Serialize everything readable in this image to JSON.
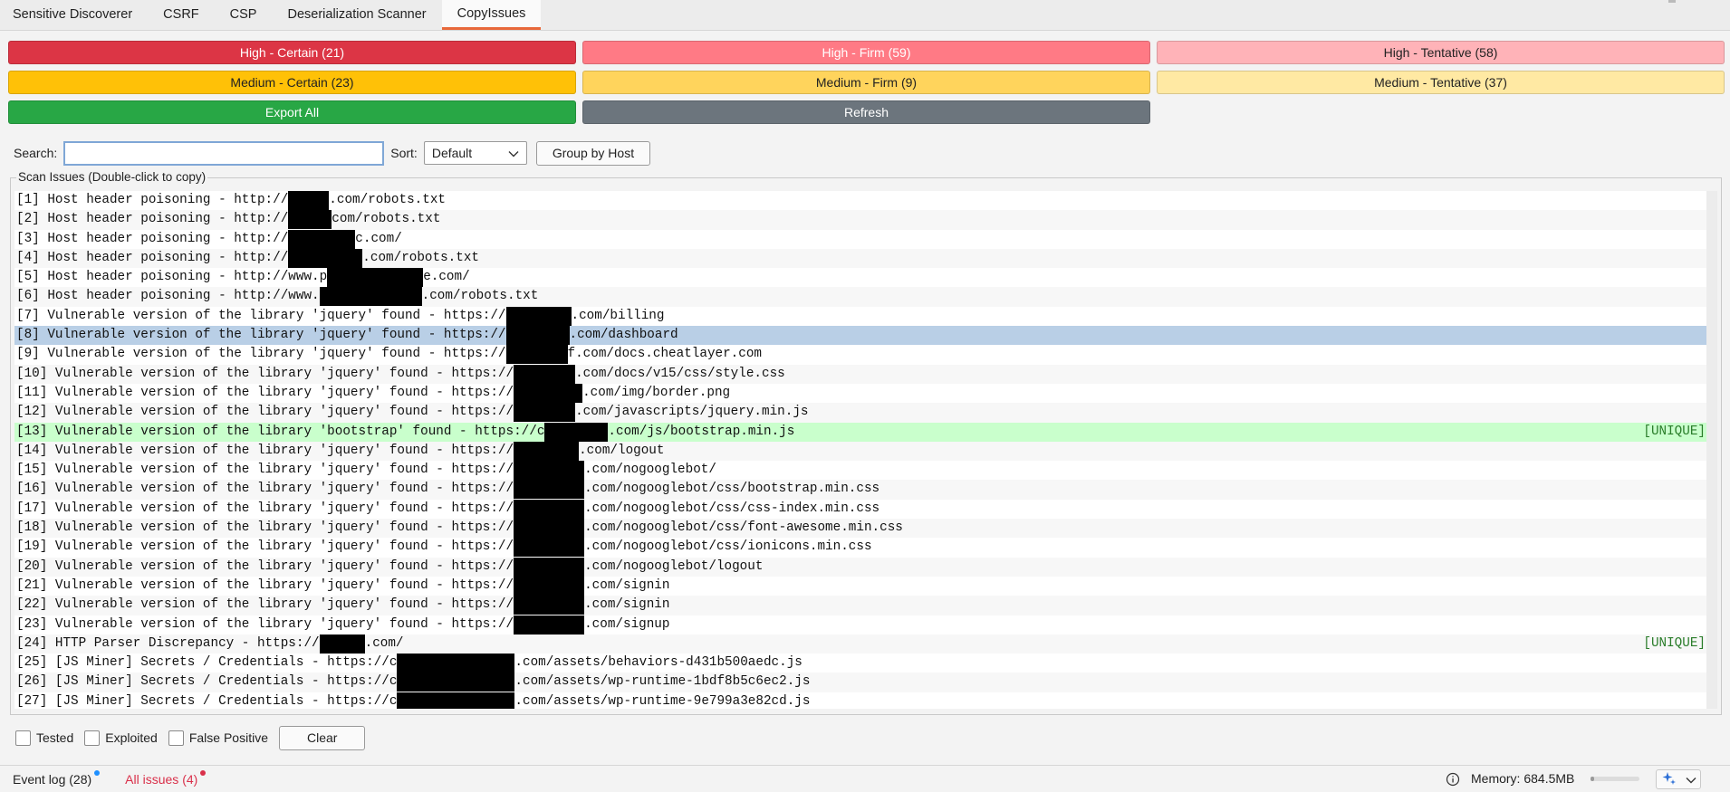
{
  "tabs": [
    {
      "label": "Sensitive Discoverer"
    },
    {
      "label": "CSRF"
    },
    {
      "label": "CSP"
    },
    {
      "label": "Deserialization Scanner"
    },
    {
      "label": "CopyIssues",
      "active": true
    }
  ],
  "severity_buttons": [
    {
      "label": "High - Certain (21)",
      "bg": "#dc3545",
      "fg": "#ffffff"
    },
    {
      "label": "High - Firm (59)",
      "bg": "#ff7a85",
      "fg": "#ffffff"
    },
    {
      "label": "High - Tentative (58)",
      "bg": "#ffb3b8",
      "fg": "#222222"
    },
    {
      "label": "Medium - Certain (23)",
      "bg": "#ffc107",
      "fg": "#222222"
    },
    {
      "label": "Medium - Firm (9)",
      "bg": "#ffd45c",
      "fg": "#222222"
    },
    {
      "label": "Medium - Tentative (37)",
      "bg": "#ffe9a3",
      "fg": "#222222"
    },
    {
      "label": "Export All",
      "bg": "#28a745",
      "fg": "#ffffff"
    },
    {
      "label": "Refresh",
      "bg": "#6c757d",
      "fg": "#ffffff"
    }
  ],
  "search": {
    "label": "Search:",
    "value": ""
  },
  "sort": {
    "label": "Sort:",
    "value": "Default"
  },
  "group_by_host_label": "Group by Host",
  "issues_panel": {
    "title": "Scan Issues (Double-click to copy)",
    "rows": [
      {
        "pre": "[1] Host header poisoning - http://",
        "redact_w": 45,
        "post": ".com/robots.txt"
      },
      {
        "pre": "[2] Host header poisoning - http://",
        "redact_w": 48,
        "post": "com/robots.txt"
      },
      {
        "pre": "[3] Host header poisoning - http://",
        "redact_w": 74,
        "post": "c.com/"
      },
      {
        "pre": "[4] Host header poisoning - http://",
        "redact_w": 82,
        "post": ".com/robots.txt"
      },
      {
        "pre": "[5] Host header poisoning - http://www.p",
        "redact_w": 106,
        "post": "e.com/"
      },
      {
        "pre": "[6] Host header poisoning - http://www.",
        "redact_w": 113,
        "post": ".com/robots.txt"
      },
      {
        "pre": "[7] Vulnerable version of the library 'jquery' found - https://",
        "redact_w": 72,
        "post": ".com/billing"
      },
      {
        "pre": "[8] Vulnerable version of the library 'jquery' found - https://",
        "redact_w": 70,
        "post": ".com/dashboard",
        "selected": true
      },
      {
        "pre": "[9] Vulnerable version of the library 'jquery' found - https://",
        "redact_w": 68,
        "post": "f.com/docs.cheatlayer.com"
      },
      {
        "pre": "[10] Vulnerable version of the library 'jquery' found - https://",
        "redact_w": 68,
        "post": ".com/docs/v15/css/style.css"
      },
      {
        "pre": "[11] Vulnerable version of the library 'jquery' found - https://",
        "redact_w": 76,
        "post": ".com/img/border.png"
      },
      {
        "pre": "[12] Vulnerable version of the library 'jquery' found - https://",
        "redact_w": 68,
        "post": ".com/javascripts/jquery.min.js"
      },
      {
        "pre": "[13] Vulnerable version of the library 'bootstrap' found - https://c",
        "redact_w": 70,
        "post": ".com/js/bootstrap.min.js",
        "badge": "[UNIQUE]",
        "unique": true
      },
      {
        "pre": "[14] Vulnerable version of the library 'jquery' found - https://",
        "redact_w": 72,
        "post": ".com/logout"
      },
      {
        "pre": "[15] Vulnerable version of the library 'jquery' found - https://",
        "redact_w": 78,
        "post": ".com/nogooglebot/"
      },
      {
        "pre": "[16] Vulnerable version of the library 'jquery' found - https://",
        "redact_w": 78,
        "post": ".com/nogooglebot/css/bootstrap.min.css"
      },
      {
        "pre": "[17] Vulnerable version of the library 'jquery' found - https://",
        "redact_w": 78,
        "post": ".com/nogooglebot/css/css-index.min.css"
      },
      {
        "pre": "[18] Vulnerable version of the library 'jquery' found - https://",
        "redact_w": 78,
        "post": ".com/nogooglebot/css/font-awesome.min.css"
      },
      {
        "pre": "[19] Vulnerable version of the library 'jquery' found - https://",
        "redact_w": 78,
        "post": ".com/nogooglebot/css/ionicons.min.css"
      },
      {
        "pre": "[20] Vulnerable version of the library 'jquery' found - https://",
        "redact_w": 78,
        "post": ".com/nogooglebot/logout"
      },
      {
        "pre": "[21] Vulnerable version of the library 'jquery' found - https://",
        "redact_w": 78,
        "post": ".com/signin"
      },
      {
        "pre": "[22] Vulnerable version of the library 'jquery' found - https://",
        "redact_w": 78,
        "post": ".com/signin"
      },
      {
        "pre": "[23] Vulnerable version of the library 'jquery' found - https://",
        "redact_w": 78,
        "post": ".com/signup"
      },
      {
        "pre": "[24] HTTP Parser Discrepancy - https://",
        "redact_w": 50,
        "post": ".com/",
        "badge": "[UNIQUE]"
      },
      {
        "pre": "[25] [JS Miner] Secrets / Credentials - https://c",
        "redact_w": 130,
        "post": ".com/assets/behaviors-d431b500aedc.js"
      },
      {
        "pre": "[26] [JS Miner] Secrets / Credentials - https://c",
        "redact_w": 130,
        "post": ".com/assets/wp-runtime-1bdf8b5c6ec2.js"
      },
      {
        "pre": "[27] [JS Miner] Secrets / Credentials - https://c",
        "redact_w": 130,
        "post": ".com/assets/wp-runtime-9e799a3e82cd.js"
      }
    ]
  },
  "checkboxes": [
    {
      "label": "Tested"
    },
    {
      "label": "Exploited"
    },
    {
      "label": "False Positive"
    }
  ],
  "clear_label": "Clear",
  "statusbar": {
    "event_log": "Event log (28)",
    "all_issues": "All issues (4)",
    "memory": "Memory: 684.5MB",
    "event_dot_color": "#1e90ff",
    "issues_dot_color": "#d9304a",
    "issues_color": "#d9304a"
  }
}
